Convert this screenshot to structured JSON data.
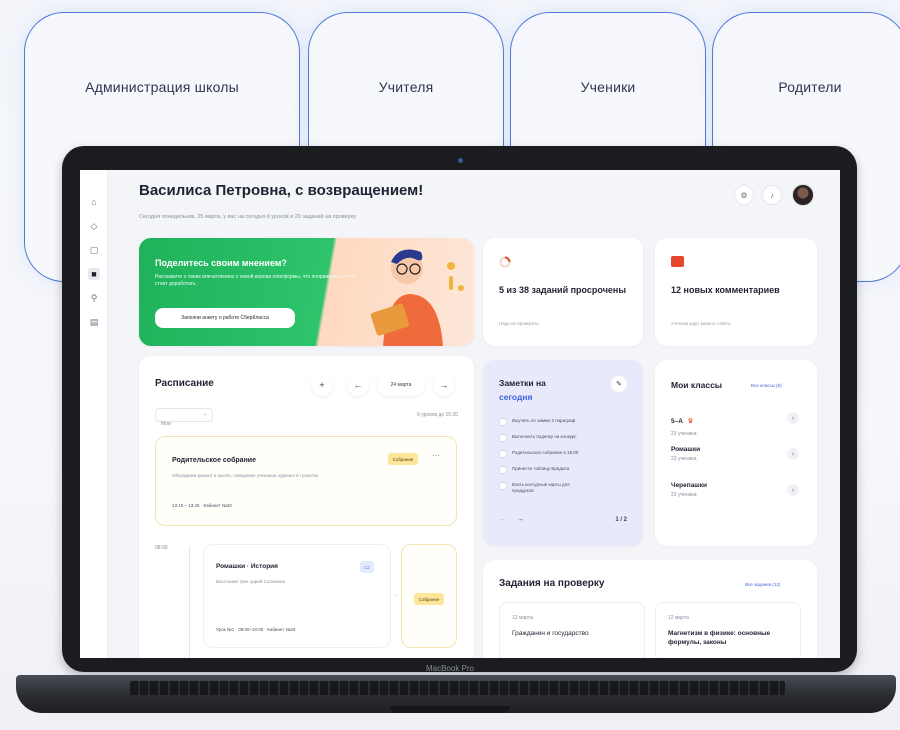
{
  "roles": [
    {
      "label": "Администрация школы"
    },
    {
      "label": "Учителя"
    },
    {
      "label": "Ученики"
    },
    {
      "label": "Родители"
    }
  ],
  "laptop": {
    "brand": "MacBook Pro"
  },
  "header": {
    "greeting": "Василиса Петровна, с возвращением!",
    "subtitle": "Сегодня понедельник, 25 марта, у вас на сегодня 6 уроков и 20 заданий на проверку"
  },
  "promo": {
    "title": "Поделитесь своим мнением?",
    "text": "Расскажите о своих впечатлениях о новой версии платформы, что понравилось и что стоит доработать",
    "button": "Заполни анкету о работе СберКласса"
  },
  "stats": {
    "overdue": {
      "title": "5 из 38 заданий просрочены",
      "sub": "Надо их проверить",
      "accent": "#e8462c"
    },
    "comments": {
      "title": "12 новых комментариев",
      "sub": "Ученики ждут вашего ответа",
      "accent": "#e8462c"
    }
  },
  "schedule": {
    "title": "Расписание",
    "date": "24 марта",
    "filter": "Мои",
    "summary": "6 уроков до 15:30",
    "event1": {
      "title": "Родительское собрание",
      "badge": "Собрание",
      "desc": "Обсуждаем ремонт в школе, поведение учеников, куренье в туалетах",
      "time": "13:15 – 13:45",
      "room": "Кабинет №33"
    },
    "time_mark": "08:00",
    "event2": {
      "title": "Ромашки · История",
      "desc": "Восстание трех царей Соломона",
      "meta": "Урок №1 · 09:00–10:00 · Кабинет №33",
      "badge": "Собрание"
    }
  },
  "notes": {
    "title": "Заметки на",
    "title_accent": "сегодня",
    "items": [
      "Выучить по химии 3 параграф",
      "Выполнить поделку на конкурс",
      "Родительское собрание в 18:00",
      "Принести таблицу Брадиса",
      "Взять контурные карты для придурков"
    ],
    "pager": "1 / 2"
  },
  "classes": {
    "title": "Мои классы",
    "link": "Все классы (6)",
    "items": [
      {
        "name": "5–А",
        "count": "23 ученика"
      },
      {
        "name": "Ромашки",
        "count": "23 ученика"
      },
      {
        "name": "Черепашки",
        "count": "23 ученика"
      }
    ]
  },
  "tasks": {
    "title": "Задания на проверку",
    "link": "Все задания (12)",
    "items": [
      {
        "date": "12 марта",
        "title": "Гражданин и государство"
      },
      {
        "date": "12 марта",
        "title": "Магнетизм в физике: основные формулы, законы"
      }
    ]
  },
  "colors": {
    "role_border": "#4d79d8",
    "promo_green": "#1fb25a",
    "notes_bg": "#e8eafc",
    "accent_blue": "#3d63dd"
  }
}
